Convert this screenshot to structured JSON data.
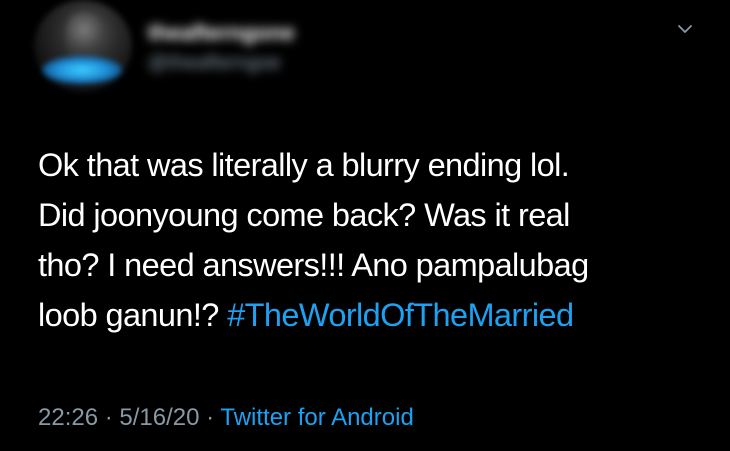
{
  "user": {
    "display_name": "theafterngone",
    "handle": "@theafterngoe"
  },
  "tweet": {
    "lines": [
      "Ok that was literally a blurry ending lol.",
      "Did joonyoung  come back? Was it real",
      "tho? I need answers!!! Ano pampalubag",
      "loob ganun!? "
    ],
    "hashtag": "#TheWorldOfTheMarried"
  },
  "meta": {
    "time": "22:26",
    "separator": " · ",
    "date": "5/16/20",
    "source": "Twitter for Android"
  },
  "colors": {
    "background": "#000000",
    "text": "#ffffff",
    "link": "#1da1f2",
    "muted": "#8899a6"
  },
  "icons": {
    "menu": "chevron-down-icon"
  }
}
